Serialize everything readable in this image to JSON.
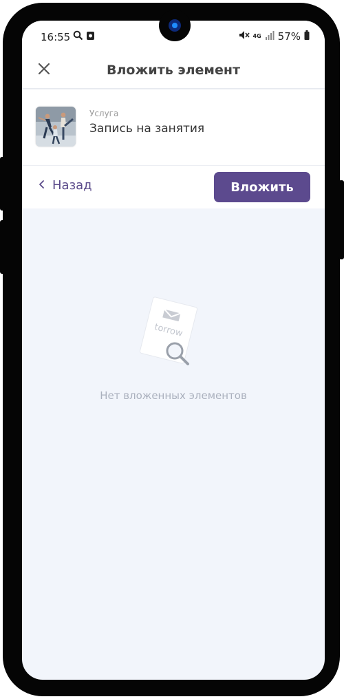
{
  "status_bar": {
    "time": "16:55",
    "network": "4G",
    "battery": "57%",
    "icons": [
      "search-icon",
      "media-icon",
      "mute-icon",
      "signal-icon",
      "battery-icon"
    ]
  },
  "header": {
    "title": "Вложить элемент",
    "close_icon": "close-icon"
  },
  "item": {
    "type": "Услуга",
    "name": "Запись на занятия"
  },
  "actions": {
    "back_label": "Назад",
    "attach_label": "Вложить"
  },
  "empty_state": {
    "text": "Нет вложенных элементов",
    "logo_text": "torrow"
  },
  "colors": {
    "accent": "#5c4a8e",
    "back_text": "#5a4a8a",
    "background": "#f2f5fb"
  }
}
